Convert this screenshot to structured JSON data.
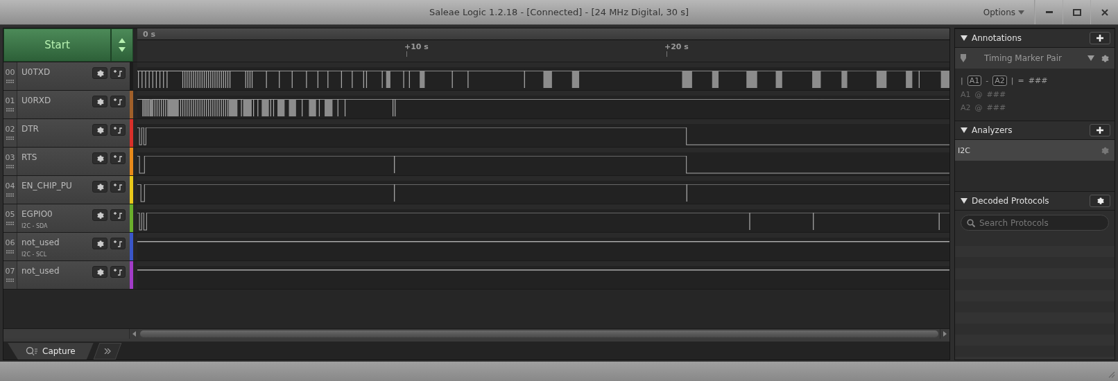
{
  "window": {
    "title": "Saleae Logic 1.2.18 - [Connected] - [24 MHz Digital, 30 s]",
    "menu": "Options"
  },
  "capture": {
    "start_label": "Start"
  },
  "timeline": {
    "origin": "0 s",
    "ticks": [
      "+10 s",
      "+20 s"
    ]
  },
  "channels": [
    {
      "number": "00",
      "name": "U0TXD",
      "color": "#1c1c1c"
    },
    {
      "number": "01",
      "name": "U0RXD",
      "color": "#a0602a"
    },
    {
      "number": "02",
      "name": "DTR",
      "color": "#d8302a"
    },
    {
      "number": "03",
      "name": "RTS",
      "color": "#e88a1a"
    },
    {
      "number": "04",
      "name": "EN_CHIP_PU",
      "color": "#e8c81a"
    },
    {
      "number": "05",
      "name": "EGPIO0",
      "analyzer": "I2C - SDA",
      "color": "#6aae2c"
    },
    {
      "number": "06",
      "name": "not_used",
      "analyzer": "I2C - SCL",
      "color": "#3a56c8"
    },
    {
      "number": "07",
      "name": "not_used",
      "color": "#a23cc8"
    }
  ],
  "bottom_tabs": [
    {
      "label": "Capture",
      "selected": true
    }
  ],
  "annotations": {
    "title": "Annotations",
    "marker": "Timing Marker Pair",
    "formula": {
      "bar_left": "|",
      "a1": "A1",
      "minus": "-",
      "a2": "A2",
      "bar_right": "|",
      "equals": "=",
      "value": "###"
    },
    "rows": [
      {
        "marker": "A1",
        "at": "@",
        "value": "###"
      },
      {
        "marker": "A2",
        "at": "@",
        "value": "###"
      }
    ]
  },
  "analyzers": {
    "title": "Analyzers",
    "items": [
      {
        "label": "I2C",
        "selected": true
      }
    ]
  },
  "decoded_protocols": {
    "title": "Decoded Protocols",
    "search": {
      "placeholder": "Search Protocols"
    }
  }
}
